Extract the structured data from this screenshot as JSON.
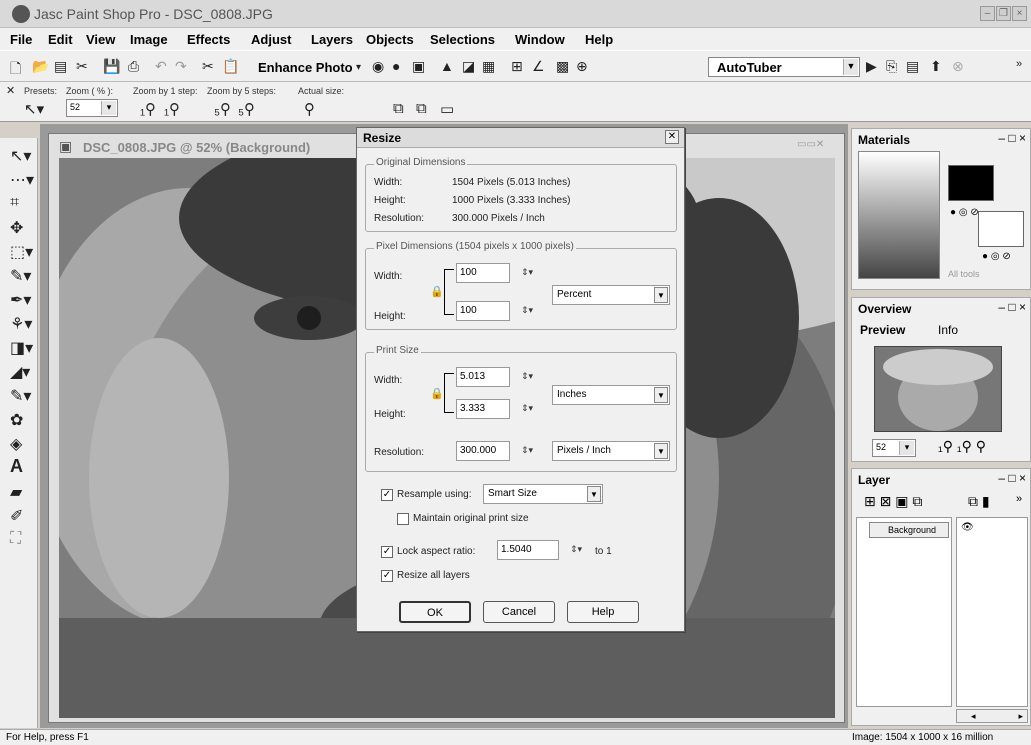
{
  "app": {
    "title": "Jasc Paint Shop Pro - DSC_0808.JPG"
  },
  "menu": [
    "File",
    "Edit",
    "View",
    "Image",
    "Effects",
    "Adjust",
    "Layers",
    "Objects",
    "Selections",
    "Window",
    "Help"
  ],
  "toolbar": {
    "enhance_label": "Enhance Photo",
    "script_value": "AutoTuber",
    "overflow": "»"
  },
  "tool_options": {
    "presets_label": "Presets:",
    "zoom_label": "Zoom ( % ):",
    "zoom_value": "52",
    "zoom1_label": "Zoom by 1 step:",
    "zoom5_label": "Zoom by 5 steps:",
    "actual_label": "Actual size:"
  },
  "image_window": {
    "title": "DSC_0808.JPG @ 52% (Background)"
  },
  "materials": {
    "title": "Materials",
    "all_tools": "All tools"
  },
  "overview": {
    "title": "Overview",
    "tab_preview": "Preview",
    "tab_info": "Info",
    "zoom_value": "52"
  },
  "layers": {
    "title": "Layer",
    "layer_name": "Background",
    "overflow": "»"
  },
  "dialog": {
    "title": "Resize",
    "original": {
      "group": "Original Dimensions",
      "width_label": "Width:",
      "width_value": "1504 Pixels (5.013 Inches)",
      "height_label": "Height:",
      "height_value": "1000 Pixels (3.333 Inches)",
      "res_label": "Resolution:",
      "res_value": "300.000 Pixels / Inch"
    },
    "pixel": {
      "group": "Pixel Dimensions (1504 pixels x 1000 pixels)",
      "width_label": "Width:",
      "width_value": "100",
      "height_label": "Height:",
      "height_value": "100",
      "unit": "Percent"
    },
    "print": {
      "group": "Print Size",
      "width_label": "Width:",
      "width_value": "5.013",
      "height_label": "Height:",
      "height_value": "3.333",
      "unit": "Inches",
      "res_label": "Resolution:",
      "res_value": "300.000",
      "res_unit": "Pixels / Inch"
    },
    "resample_label": "Resample using:",
    "resample_value": "Smart Size",
    "maintain_label": "Maintain original print size",
    "lock_label": "Lock aspect ratio:",
    "lock_value": "1.5040",
    "to_label": "to 1",
    "resize_layers_label": "Resize all layers",
    "ok": "OK",
    "cancel": "Cancel",
    "help": "Help"
  },
  "status": {
    "left": "For Help, press F1",
    "right": "Image:  1504 x 1000 x 16 million"
  }
}
